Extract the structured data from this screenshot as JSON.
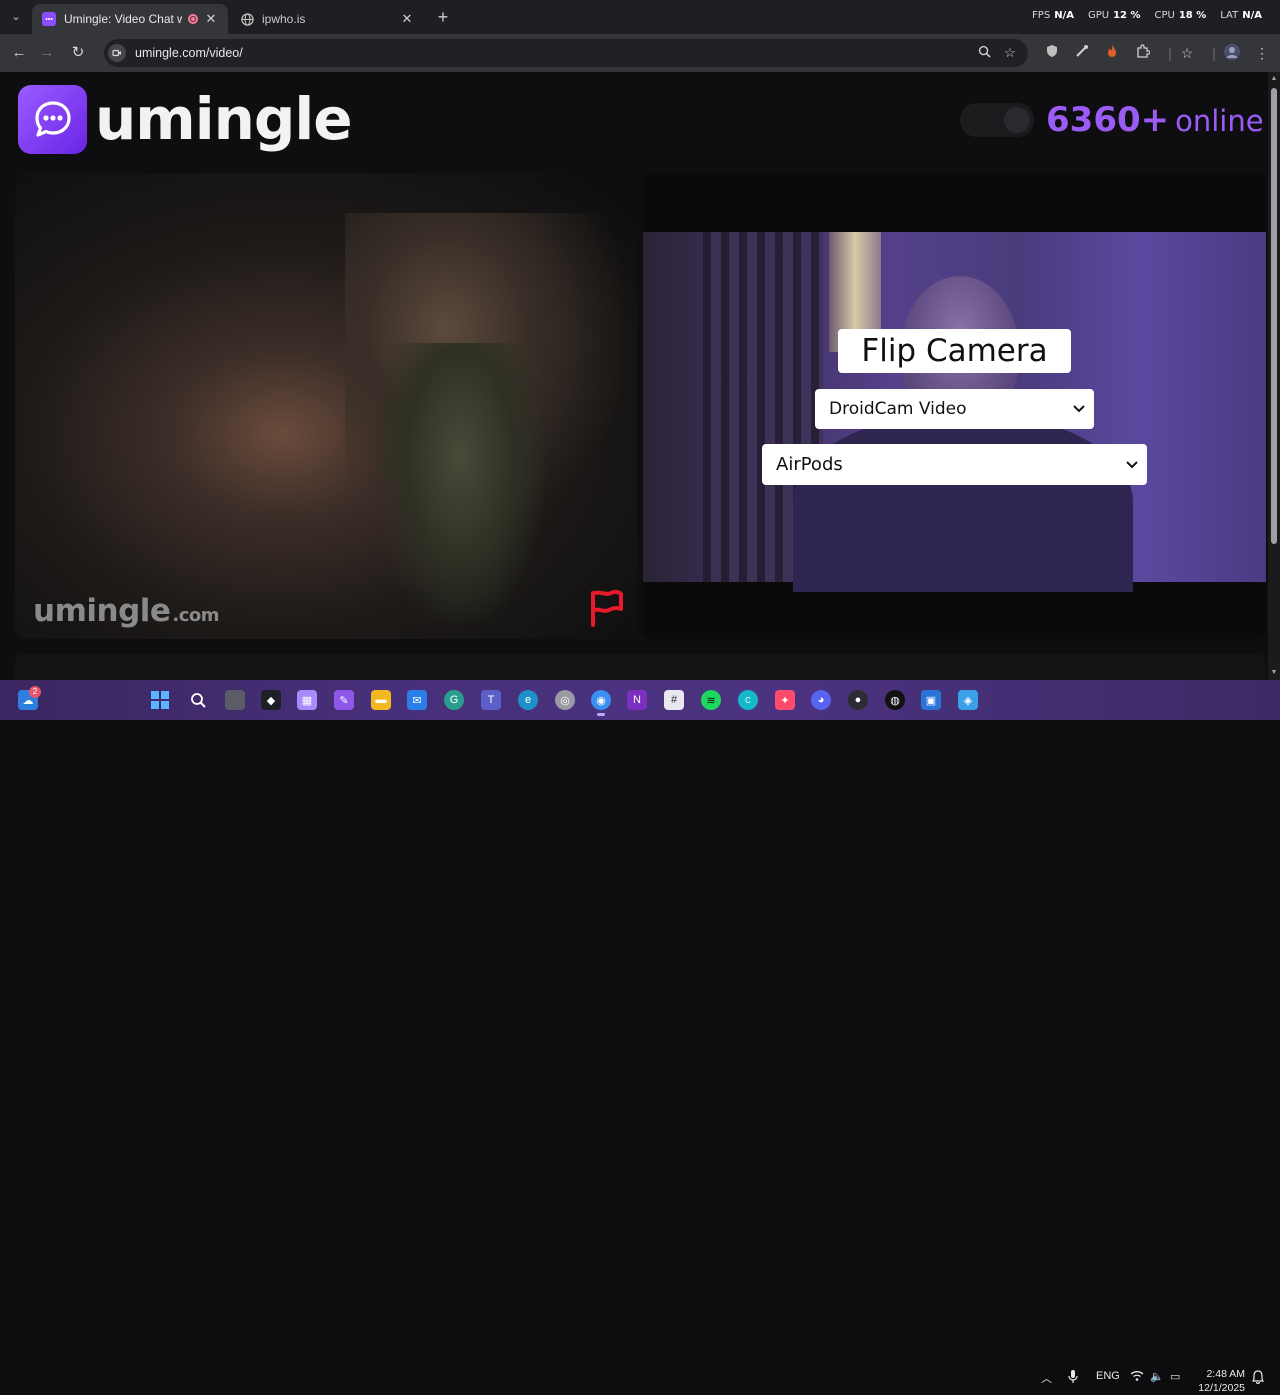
{
  "browser": {
    "tabs": [
      {
        "title": "Umingle: Video Chat with St",
        "active": true,
        "recording": true
      },
      {
        "title": "ipwho.is",
        "active": false
      }
    ],
    "stats": [
      {
        "label": "FPS",
        "value": "N/A"
      },
      {
        "label": "GPU",
        "value": "12 %"
      },
      {
        "label": "CPU",
        "value": "18 %"
      },
      {
        "label": "LAT",
        "value": "N/A"
      }
    ],
    "url": "umingle.com/video/"
  },
  "site": {
    "logo_text": "umingle",
    "online_count": "6360+",
    "online_label": "online",
    "watermark_main": "umingle",
    "watermark_domain": ".com",
    "flip_camera_label": "Flip Camera",
    "video_source": "DroidCam Video",
    "audio_source": "AirPods",
    "accent_color": "#9b5cf6"
  },
  "taskbar": {
    "notification_count": "2",
    "language": "ENG",
    "time": "2:48 AM",
    "date": "12/1/2025"
  }
}
